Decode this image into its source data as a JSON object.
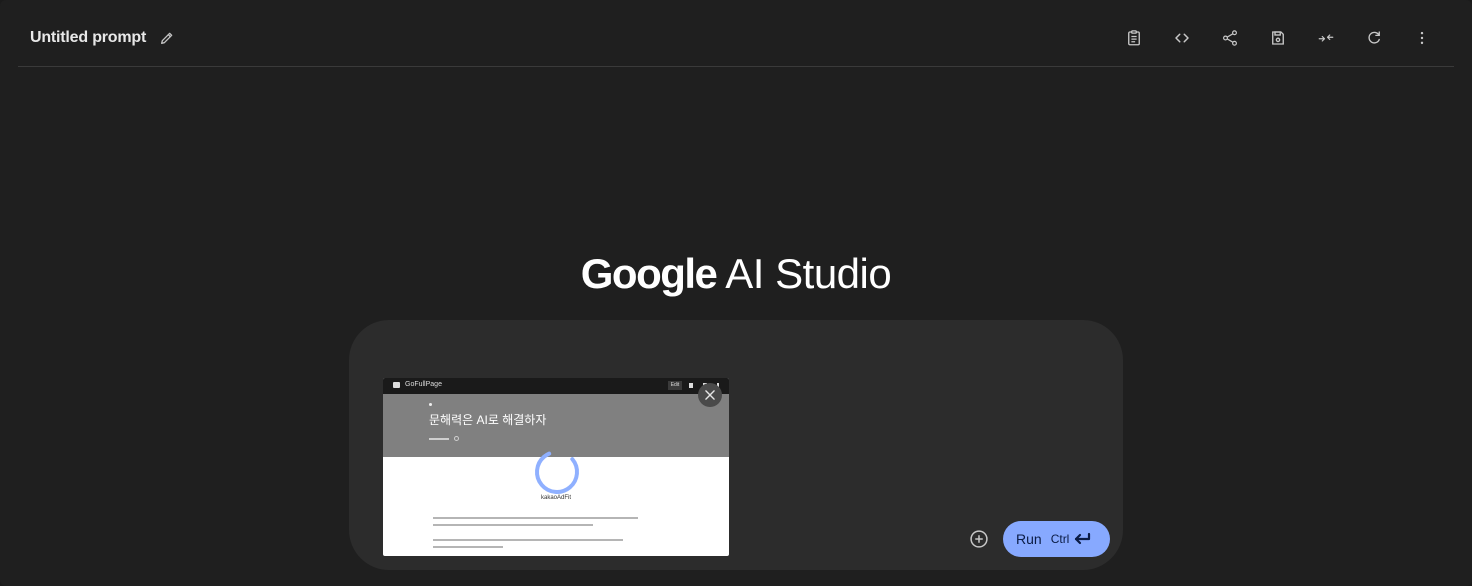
{
  "header": {
    "title": "Untitled prompt"
  },
  "toolbar": {
    "items": [
      {
        "icon": "clipboard-icon"
      },
      {
        "icon": "code-icon"
      },
      {
        "icon": "share-icon"
      },
      {
        "icon": "save-icon"
      },
      {
        "icon": "compare-icon"
      },
      {
        "icon": "refresh-icon"
      },
      {
        "icon": "more-vert-icon"
      }
    ]
  },
  "brand": {
    "google": "Google",
    "product": "AI Studio"
  },
  "attachment": {
    "app_name": "GoFullPage",
    "edit_tag": "Edit",
    "headline": "문해력은 AI로 해결하자",
    "ad_label": "kakaoAdFit"
  },
  "composer": {
    "run_label": "Run",
    "run_shortcut": "Ctrl"
  },
  "colors": {
    "background": "#1f1f1f",
    "composer": "#2c2c2c",
    "run_button": "#87a9ff"
  }
}
